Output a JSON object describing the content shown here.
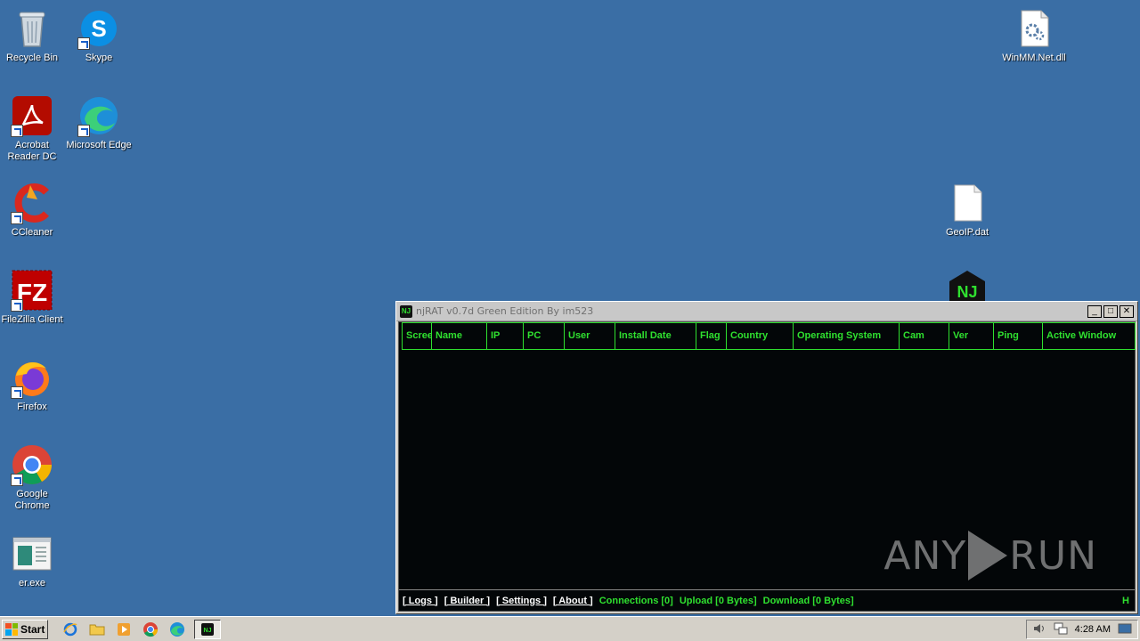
{
  "desktop": {
    "icons": [
      {
        "label": "Recycle Bin"
      },
      {
        "label": "Skype"
      },
      {
        "label": "Acrobat Reader DC"
      },
      {
        "label": "Microsoft Edge"
      },
      {
        "label": "CCleaner"
      },
      {
        "label": "FileZilla Client"
      },
      {
        "label": "Firefox"
      },
      {
        "label": "Google Chrome"
      },
      {
        "label": "er.exe"
      },
      {
        "label": "WinMM.Net.dll"
      },
      {
        "label": "GeoIP.dat"
      }
    ]
  },
  "window": {
    "title": "njRAT v0.7d Green Edition By im523",
    "icon_text": "NJ",
    "buttons": {
      "minimize": "_",
      "maximize": "□",
      "close": "✕"
    },
    "columns": [
      "Screen",
      "Name",
      "IP",
      "PC",
      "User",
      "Install Date",
      "Flag",
      "Country",
      "Operating System",
      "Cam",
      "Ver",
      "Ping",
      "Active Window"
    ],
    "status": {
      "logs": "[ Logs ]",
      "builder": "[ Builder ]",
      "settings": "[ Settings ]",
      "about": "[ About ]",
      "connections": "Connections [0]",
      "upload": "Upload [0 Bytes]",
      "download": "Download [0 Bytes]",
      "right_indicator": "H"
    },
    "watermark": {
      "left": "ANY",
      "right": "RUN"
    }
  },
  "taskbar": {
    "start_label": "Start",
    "clock": "4:28 AM"
  },
  "colors": {
    "desktop": "#3a6ea5",
    "accent_green": "#2fe02f",
    "client_bg": "#030608"
  }
}
